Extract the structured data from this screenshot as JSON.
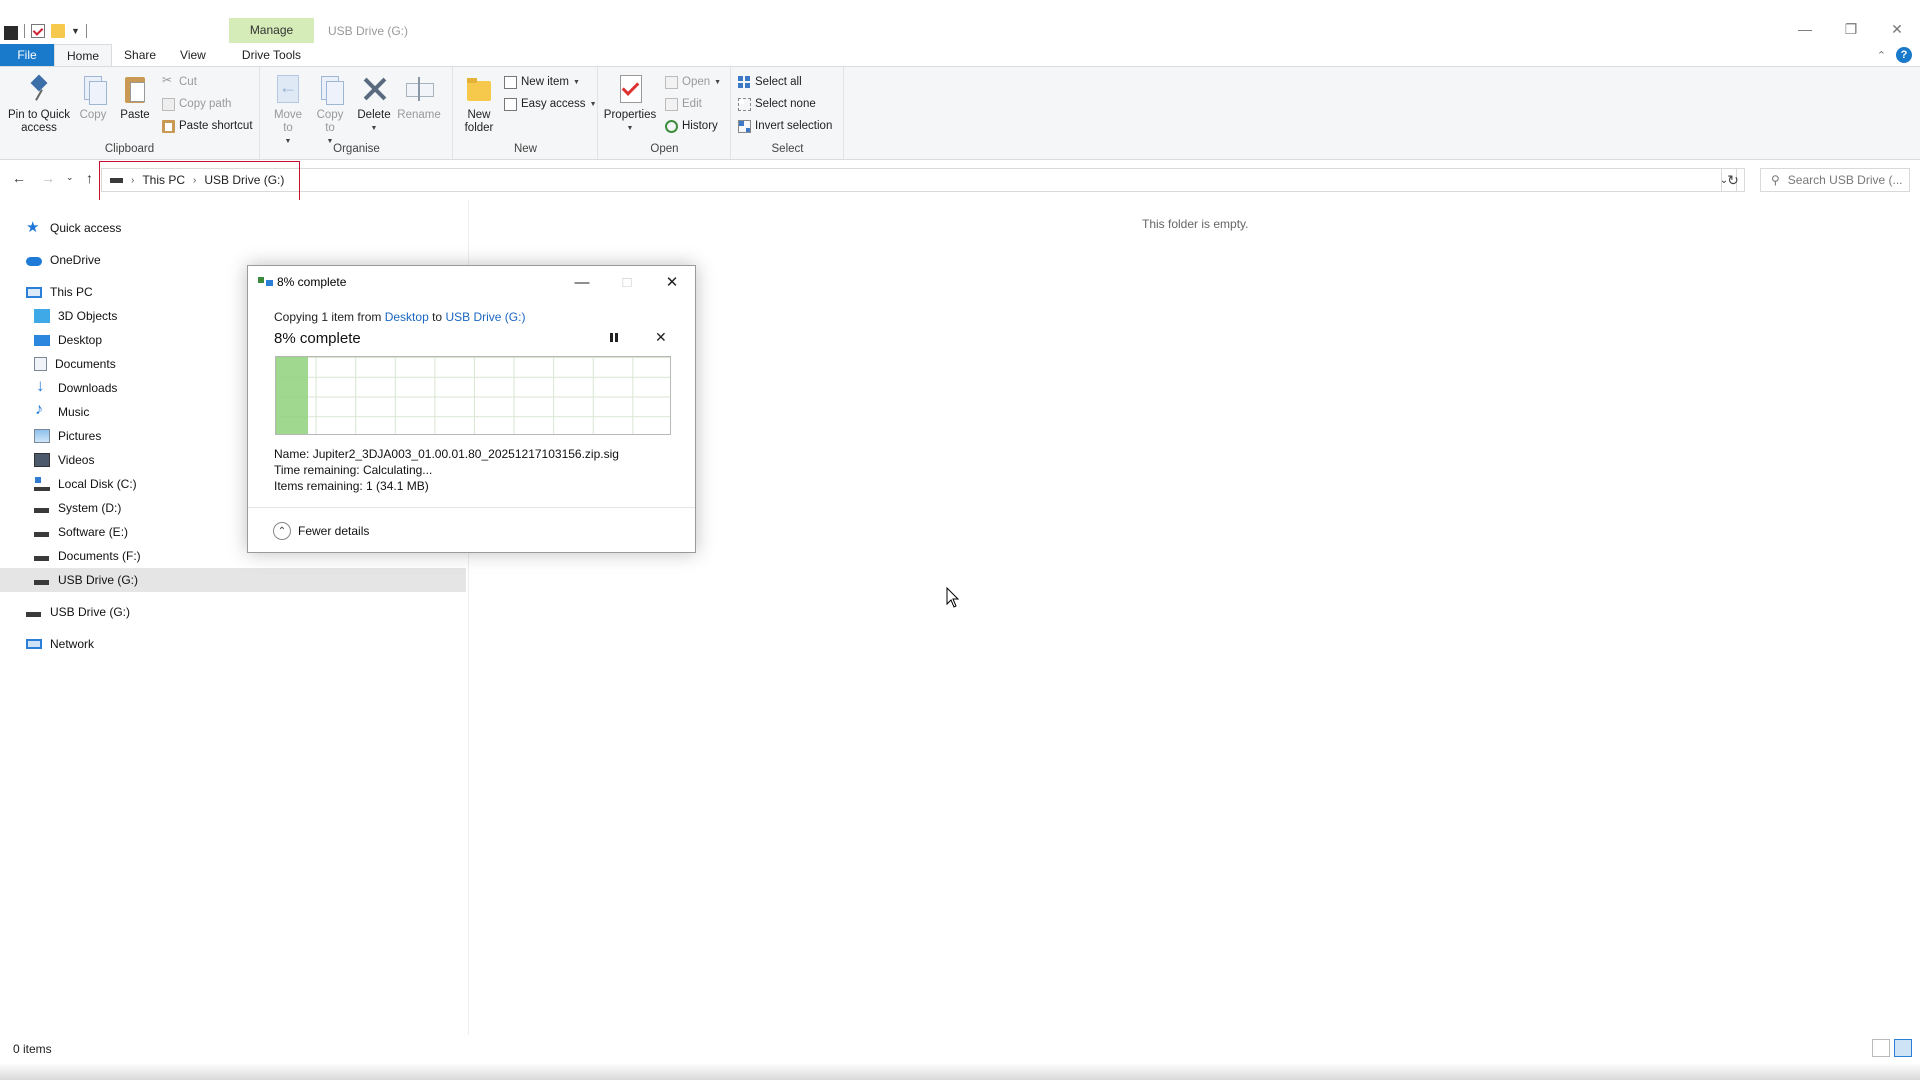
{
  "window": {
    "title": "USB Drive (G:)",
    "context_tab": "Manage",
    "controls": {
      "minimize": "—",
      "maximize": "❐",
      "close": "✕"
    }
  },
  "ribbon": {
    "tabs": [
      "File",
      "Home",
      "Share",
      "View",
      "Drive Tools"
    ],
    "groups": {
      "clipboard": {
        "label": "Clipboard",
        "pin": "Pin to Quick access",
        "copy": "Copy",
        "paste": "Paste",
        "cut": "Cut",
        "copy_path": "Copy path",
        "paste_shortcut": "Paste shortcut"
      },
      "organise": {
        "label": "Organise",
        "move_to": "Move to",
        "copy_to": "Copy to",
        "delete": "Delete",
        "rename": "Rename"
      },
      "new": {
        "label": "New",
        "new_folder": "New folder",
        "new_item": "New item",
        "easy_access": "Easy access"
      },
      "open": {
        "label": "Open",
        "properties": "Properties",
        "open": "Open",
        "edit": "Edit",
        "history": "History"
      },
      "select": {
        "label": "Select",
        "select_all": "Select all",
        "select_none": "Select none",
        "invert_selection": "Invert selection"
      }
    },
    "help": "?"
  },
  "address_bar": {
    "breadcrumbs": [
      "This PC",
      "USB Drive (G:)"
    ],
    "search_placeholder": "Search USB Drive (..."
  },
  "nav_pane": {
    "items": [
      {
        "label": "Quick access",
        "icon": "star-icon"
      },
      {
        "label": "OneDrive",
        "icon": "cloud-icon"
      },
      {
        "label": "This PC",
        "icon": "computer-icon"
      },
      {
        "label": "3D Objects",
        "icon": "cube-icon"
      },
      {
        "label": "Desktop",
        "icon": "desktop-icon"
      },
      {
        "label": "Documents",
        "icon": "document-icon"
      },
      {
        "label": "Downloads",
        "icon": "download-icon"
      },
      {
        "label": "Music",
        "icon": "music-icon"
      },
      {
        "label": "Pictures",
        "icon": "picture-icon"
      },
      {
        "label": "Videos",
        "icon": "video-icon"
      },
      {
        "label": "Local Disk (C:)",
        "icon": "local-disk-icon"
      },
      {
        "label": "System (D:)",
        "icon": "drive-icon"
      },
      {
        "label": "Software (E:)",
        "icon": "drive-icon"
      },
      {
        "label": "Documents (F:)",
        "icon": "drive-icon"
      },
      {
        "label": "USB Drive (G:)",
        "icon": "drive-icon",
        "selected": true
      },
      {
        "label": "USB Drive (G:)",
        "icon": "drive-icon"
      },
      {
        "label": "Network",
        "icon": "network-icon"
      }
    ]
  },
  "content": {
    "empty_message": "This folder is empty."
  },
  "status_bar": {
    "item_count": "0 items"
  },
  "copy_dialog": {
    "title": "8% complete",
    "copying_prefix": "Copying 1 item from",
    "source": "Desktop",
    "to_word": "to",
    "destination": "USB Drive (G:)",
    "percent_label": "8% complete",
    "progress": 0.08,
    "name_label": "Name:",
    "name_value": "Jupiter2_3DJA003_01.00.01.80_20251217103156.zip.sig",
    "time_label": "Time remaining:",
    "time_value": "Calculating...",
    "items_label": "Items remaining:",
    "items_value": "1 (34.1 MB)",
    "fewer_details": "Fewer details"
  },
  "colors": {
    "file_tab": "#1979ca",
    "manage_tab": "#d5ecb8",
    "progress_fill": "#8fd17c",
    "highlight_box": "#c8102e",
    "link": "#1a66c2"
  }
}
